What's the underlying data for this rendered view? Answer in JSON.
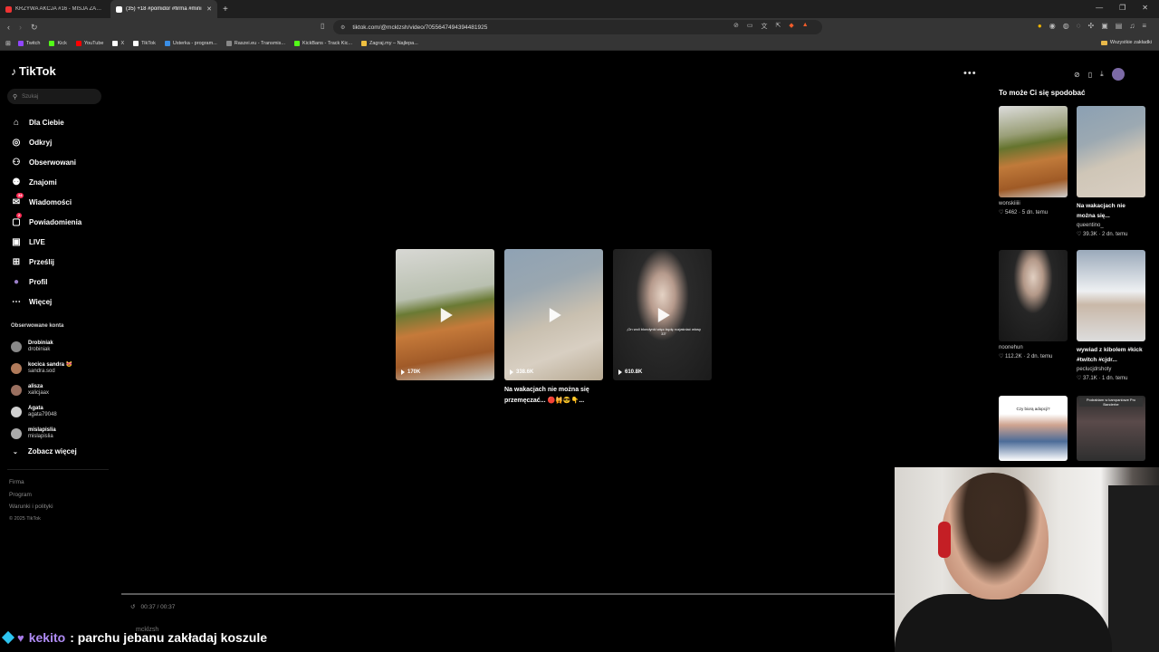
{
  "browser": {
    "tabs": [
      {
        "title": "KRZYWA AKCJA #16 - MISJA ZAMOCZENIE",
        "color": "#e33"
      },
      {
        "title": "(35) +18 #pomidor #firma #mini",
        "color": "#fff"
      }
    ],
    "url": "tiktok.com/@mcklzsh/video/7055647494394481925",
    "bookmarks": [
      {
        "label": "Twitch",
        "color": "#9146ff"
      },
      {
        "label": "Kick",
        "color": "#53fc18"
      },
      {
        "label": "YouTube",
        "color": "#ff0000"
      },
      {
        "label": "X",
        "color": "#ffffff"
      },
      {
        "label": "TikTok",
        "color": "#ffffff"
      },
      {
        "label": "Usterka - program...",
        "color": "#3a8ee6"
      },
      {
        "label": "Raszei.eu - Transmis...",
        "color": "#888888"
      },
      {
        "label": "KickBans - Track Kic...",
        "color": "#53fc18"
      },
      {
        "label": "Zagraj.my – Najlepa...",
        "color": "#f0c040"
      }
    ],
    "all_bookmarks": "Wszystkie zakładki"
  },
  "sidebar": {
    "logo": "TikTok",
    "search_placeholder": "Szukaj",
    "menu": [
      {
        "label": "Dla Ciebie",
        "icon": "home-icon"
      },
      {
        "label": "Odkryj",
        "icon": "compass-icon"
      },
      {
        "label": "Obserwowani",
        "icon": "following-icon"
      },
      {
        "label": "Znajomi",
        "icon": "friends-icon"
      },
      {
        "label": "Wiadomości",
        "icon": "messages-icon",
        "badge": "34"
      },
      {
        "label": "Powiadomienia",
        "icon": "notifications-icon",
        "badge": "2"
      },
      {
        "label": "LIVE",
        "icon": "live-icon"
      },
      {
        "label": "Prześlij",
        "icon": "upload-icon"
      },
      {
        "label": "Profil",
        "icon": "profile-icon"
      },
      {
        "label": "Więcej",
        "icon": "more-icon"
      }
    ],
    "followed_title": "Obserwowane konta",
    "followed": [
      {
        "name": "Drobiniak",
        "handle": "drobiniak"
      },
      {
        "name": "kocica sandra 😻",
        "handle": "sandra.sod"
      },
      {
        "name": "alisza",
        "handle": "xalicjaax"
      },
      {
        "name": "Agata",
        "handle": "agata79048"
      },
      {
        "name": "mislapisl​ia",
        "handle": "mislapislia"
      }
    ],
    "see_more": "Zobacz więcej",
    "footer": [
      "Firma",
      "Program",
      "Warunki i polityki"
    ],
    "copyright": "© 2025 TikTok"
  },
  "main": {
    "videos": [
      {
        "views": "170K",
        "caption": "",
        "overlay": ""
      },
      {
        "views": "338.6K",
        "caption": "Na wakacjach nie można się przemęczać... 🔴🙀😎👇...",
        "overlay": ""
      },
      {
        "views": "610.8K",
        "caption": "",
        "overlay": "„On woli blondynki więc będę rozjaśniać włosy 33”"
      }
    ],
    "time": "00:37 / 00:37"
  },
  "right_rail": {
    "title": "To może Ci się spodobać",
    "items": [
      {
        "title": "",
        "user": "wonskiiiii",
        "meta": "♡ 5462 · 5 dn. temu"
      },
      {
        "title": "Na wakacjach nie można się...",
        "user": "queentino_",
        "meta": "♡ 39.3K · 2 dn. temu"
      },
      {
        "title": "",
        "user": "noonehun",
        "meta": "♡ 112.2K · 2 dn. temu"
      },
      {
        "title": "wywiad z kibolem #kick #twitch #cjdr...",
        "user": "peclucjdrshoty",
        "meta": "♡ 37.1K · 1 dn. temu"
      },
      {
        "title": "",
        "user": "",
        "meta": "",
        "overlay": "Czy biorą adopcji?"
      },
      {
        "title": "",
        "user": "",
        "meta": "",
        "overlay": "Podrabiam w kampaniowe Pro Banderbe"
      }
    ]
  },
  "stream": {
    "chat_user": "kekito",
    "chat_message": ": parchu jebanu zakładaj koszule",
    "faint_author": "mcklzsh"
  }
}
